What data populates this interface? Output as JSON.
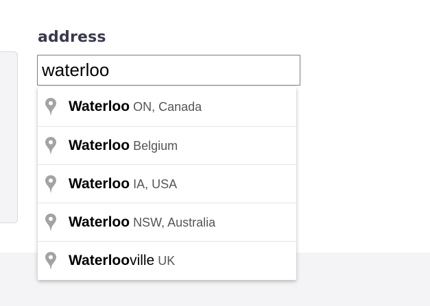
{
  "form": {
    "label": "address",
    "input_value": "waterloo"
  },
  "autocomplete": {
    "items": [
      {
        "icon": "map-pin-icon",
        "match": "Waterloo",
        "rest": "",
        "secondary": "ON, Canada"
      },
      {
        "icon": "map-pin-icon",
        "match": "Waterloo",
        "rest": "",
        "secondary": "Belgium"
      },
      {
        "icon": "map-pin-icon",
        "match": "Waterloo",
        "rest": "",
        "secondary": "IA, USA"
      },
      {
        "icon": "map-pin-icon",
        "match": "Waterloo",
        "rest": "",
        "secondary": "NSW, Australia"
      },
      {
        "icon": "map-pin-icon",
        "match": "Waterloo",
        "rest": "ville",
        "secondary": "UK"
      }
    ]
  },
  "colors": {
    "label": "#3a3a4e",
    "pin": "#a3a3a3",
    "page_bottom": "#f4f4f6"
  }
}
